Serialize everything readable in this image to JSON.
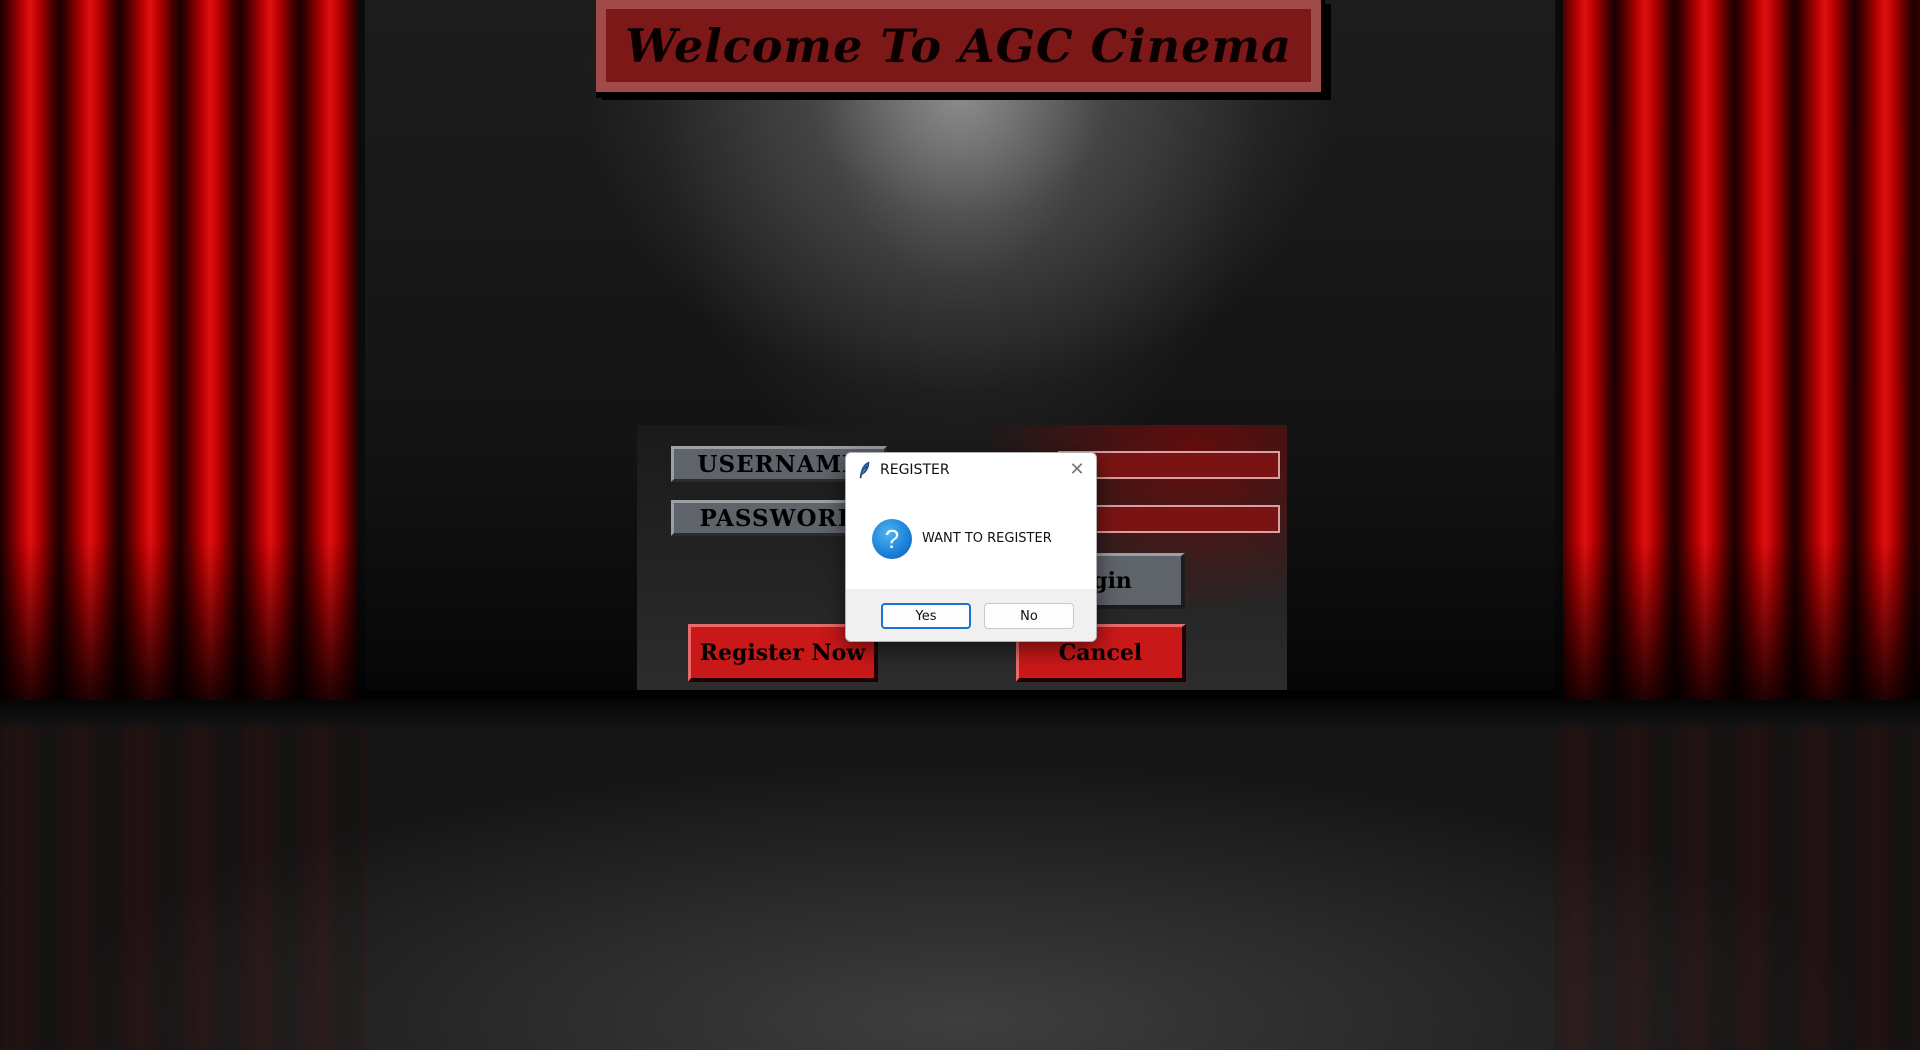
{
  "banner": {
    "title": "Welcome To AGC Cinema"
  },
  "login": {
    "username_label": "USERNAME",
    "password_label": "PASSWORD",
    "username_value": "",
    "password_value": "",
    "login_label": "Login",
    "register_label": "Register Now",
    "cancel_label": "Cancel"
  },
  "dialog": {
    "title": "REGISTER",
    "close_glyph": "✕",
    "icon_glyph": "?",
    "message": "WANT TO REGISTER",
    "yes_label": "Yes",
    "no_label": "No"
  },
  "colors": {
    "curtain_red": "#c00000",
    "banner_red": "#7c1818",
    "button_red": "#c81818",
    "button_gray": "#5f646b",
    "dialog_accent": "#1a73d0"
  },
  "icons": {
    "dialog_app": "feather-icon",
    "dialog_question": "question-icon",
    "dialog_close": "close-icon"
  }
}
